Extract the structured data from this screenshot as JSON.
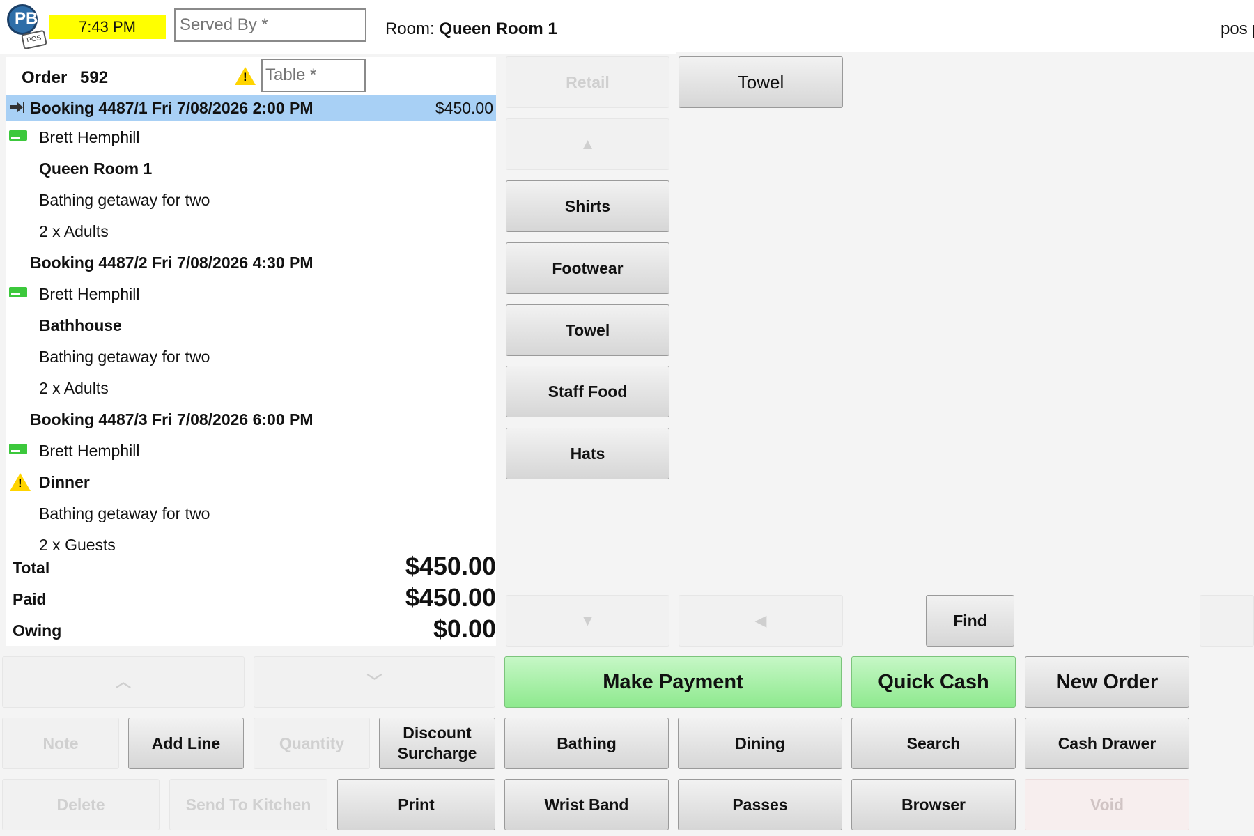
{
  "header": {
    "clock": "7:43 PM",
    "served_by_placeholder": "Served By *",
    "room_label": "Room:",
    "room_value": "Queen Room 1",
    "user": "pos p",
    "logo_text": "PB",
    "logo_tag": "POS"
  },
  "order": {
    "label": "Order",
    "number": "592",
    "table_placeholder": "Table *",
    "lines": [
      {
        "kind": "booking",
        "text": "Booking 4487/1 Fri 7/08/2026 2:00 PM",
        "amount": "$450.00",
        "selected": true
      },
      {
        "kind": "customer",
        "text": "Brett Hemphill"
      },
      {
        "kind": "resource",
        "text": "Queen Room 1"
      },
      {
        "kind": "package",
        "text": "Bathing getaway for two"
      },
      {
        "kind": "qty",
        "text": "2 x Adults"
      },
      {
        "kind": "booking",
        "text": "Booking 4487/2 Fri 7/08/2026 4:30 PM"
      },
      {
        "kind": "customer",
        "text": "Brett Hemphill"
      },
      {
        "kind": "resource",
        "text": "Bathhouse"
      },
      {
        "kind": "package",
        "text": "Bathing getaway for two"
      },
      {
        "kind": "qty",
        "text": "2 x Adults"
      },
      {
        "kind": "booking",
        "text": "Booking 4487/3 Fri 7/08/2026 6:00 PM"
      },
      {
        "kind": "customer",
        "text": "Brett Hemphill"
      },
      {
        "kind": "resource-warn",
        "text": "Dinner"
      },
      {
        "kind": "package",
        "text": "Bathing getaway for two"
      },
      {
        "kind": "qty",
        "text": "2 x Guests"
      }
    ],
    "totals": {
      "total_label": "Total",
      "total_value": "$450.00",
      "paid_label": "Paid",
      "paid_value": "$450.00",
      "owing_label": "Owing",
      "owing_value": "$0.00"
    }
  },
  "categories": {
    "retail": "Retail",
    "items": [
      "Shirts",
      "Footwear",
      "Towel",
      "Staff Food",
      "Hats"
    ]
  },
  "products": {
    "items": [
      "Towel"
    ],
    "find": "Find"
  },
  "actions": {
    "note": "Note",
    "add_line": "Add Line",
    "quantity": "Quantity",
    "discount_line1": "Discount",
    "discount_line2": "Surcharge",
    "delete": "Delete",
    "send_to_kitchen": "Send To Kitchen",
    "print": "Print",
    "make_payment": "Make Payment",
    "quick_cash": "Quick Cash",
    "new_order": "New Order",
    "bathing": "Bathing",
    "dining": "Dining",
    "search": "Search",
    "cash_drawer": "Cash Drawer",
    "wrist_band": "Wrist Band",
    "passes": "Passes",
    "browser": "Browser",
    "void": "Void"
  },
  "colors": {
    "clock_bg": "#ffff00",
    "selected_row": "#a8d0f5",
    "payment_green": "#8ee98e",
    "customer_card": "#3cc83c",
    "warning": "#ffd400"
  }
}
